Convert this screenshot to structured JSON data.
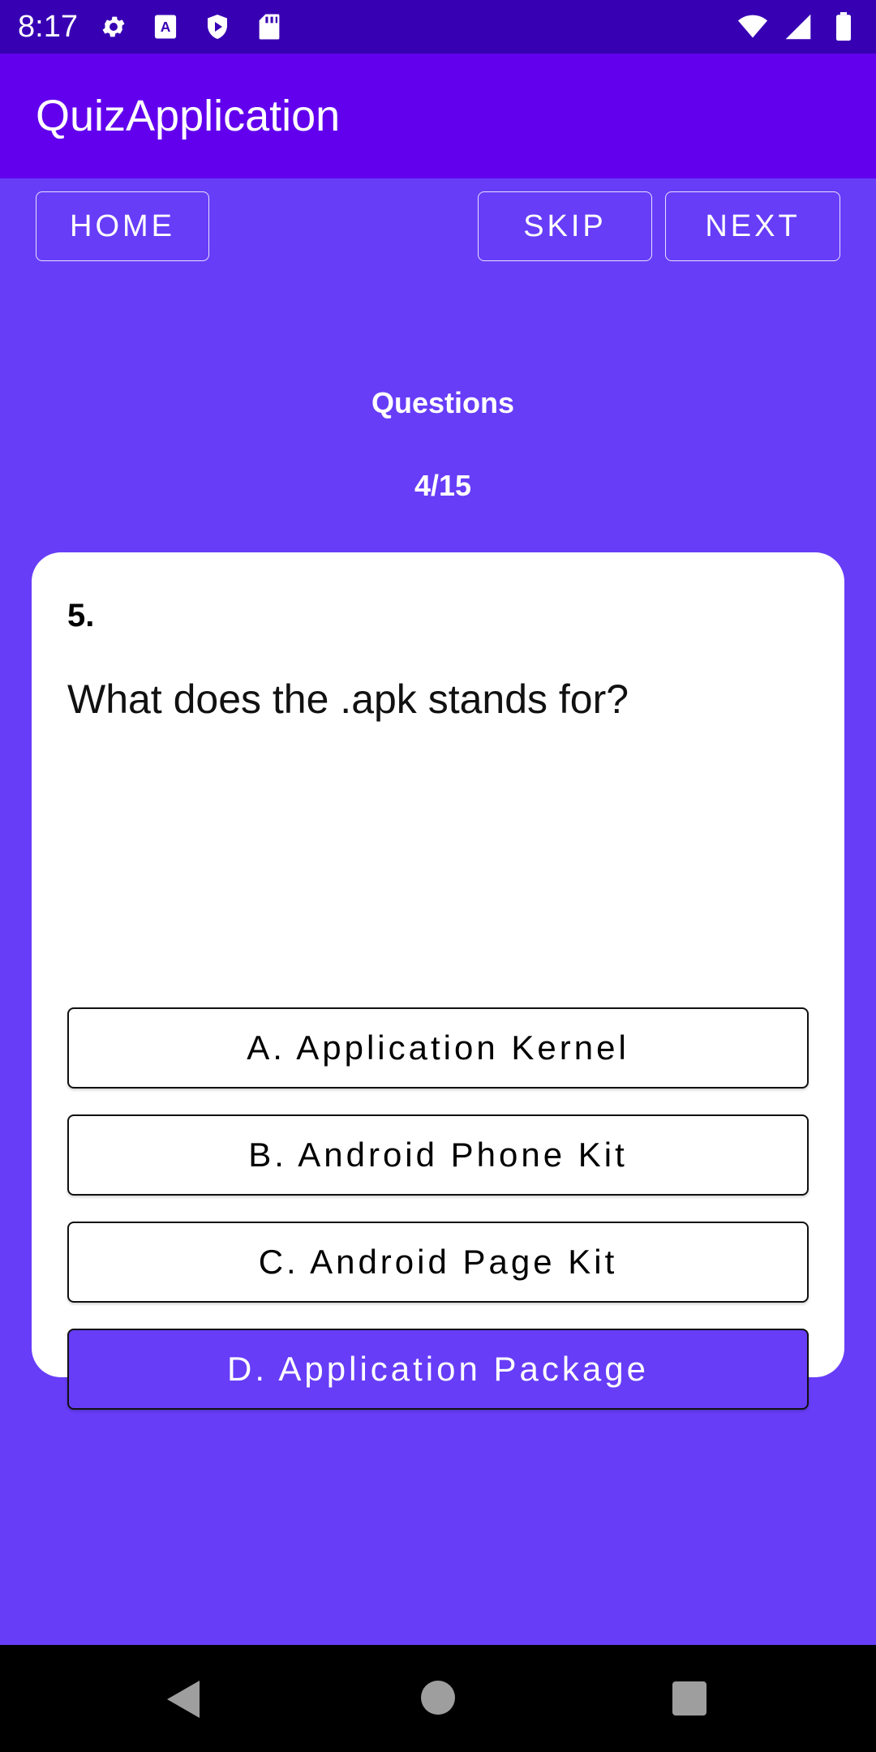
{
  "status_bar": {
    "time": "8:17",
    "left_icons": [
      "gear-icon",
      "a-box-icon",
      "shield-play-icon",
      "sd-card-icon"
    ],
    "right_icons": [
      "wifi-icon",
      "signal-icon",
      "battery-icon"
    ]
  },
  "app_bar": {
    "title": "QuizApplication"
  },
  "nav_buttons": {
    "home": "HOME",
    "skip": "SKIP",
    "next": "NEXT"
  },
  "progress": {
    "label": "Questions",
    "count": "4/15"
  },
  "question": {
    "number": "5.",
    "text": "What does the .apk stands for?",
    "options": [
      {
        "label": "A. Application Kernel",
        "selected": false
      },
      {
        "label": "B. Android Phone Kit",
        "selected": false
      },
      {
        "label": "C. Android Page Kit",
        "selected": false
      },
      {
        "label": "D. Application Package",
        "selected": true
      }
    ]
  },
  "colors": {
    "status_bar": "#3700b3",
    "app_bar": "#6200ee",
    "background": "#673df8",
    "selected_option": "#673df8"
  },
  "system_nav": [
    "back-icon",
    "home-circle-icon",
    "recents-square-icon"
  ]
}
